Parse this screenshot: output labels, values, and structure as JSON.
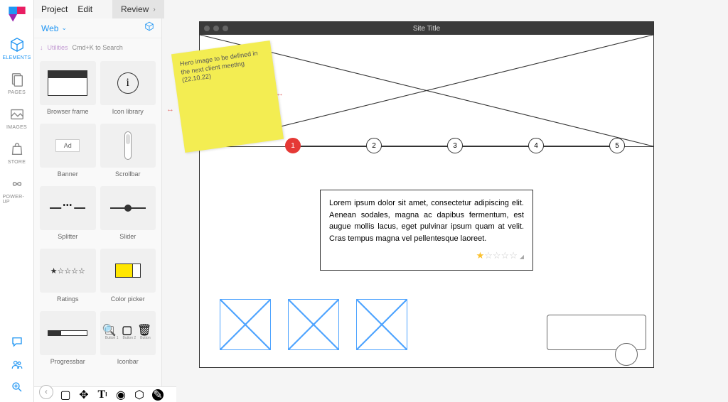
{
  "sidebar": {
    "items": [
      {
        "label": "ELEMENTS",
        "icon": "cube"
      },
      {
        "label": "PAGES",
        "icon": "pages"
      },
      {
        "label": "IMAGES",
        "icon": "images"
      },
      {
        "label": "STORE",
        "icon": "bag"
      },
      {
        "label": "POWER-UP",
        "icon": "infinity"
      }
    ]
  },
  "menu": {
    "project": "Project",
    "edit": "Edit",
    "review": "Review"
  },
  "panel": {
    "selector": "Web",
    "utilities": "Utilities",
    "search_ph": "Cmd+K to Search",
    "elements": [
      [
        "Browser frame",
        "Icon library"
      ],
      [
        "Banner",
        "Scrollbar"
      ],
      [
        "Splitter",
        "Slider"
      ],
      [
        "Ratings",
        "Color picker"
      ],
      [
        "Progressbar",
        "Iconbar"
      ]
    ],
    "iconbar_btns": [
      "Button 1",
      "Button 2",
      "Button"
    ]
  },
  "window": {
    "title": "Site Title",
    "steps": [
      "1",
      "2",
      "3",
      "4",
      "5"
    ],
    "body_text": "Lorem ipsum dolor sit amet, consectetur adipiscing elit. Aenean sodales, magna ac dapibus fermentum, est augue mollis lacus, eget pulvinar ipsum quam at velit. Cras tempus magna vel pellentesque laoreet.",
    "rating": {
      "filled": 1,
      "total": 5
    }
  },
  "sticky": {
    "text": "Hero image to be defined in the next client meeting (22.10.22)"
  }
}
